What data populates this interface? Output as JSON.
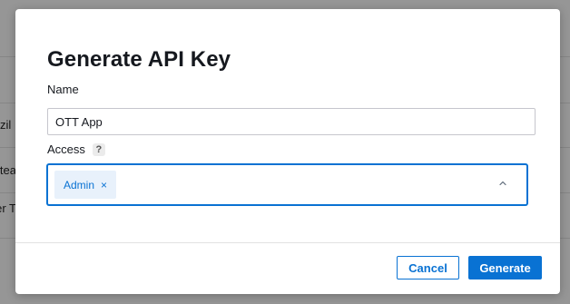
{
  "background": {
    "rows": [
      "zil",
      "tea",
      "er T"
    ]
  },
  "modal": {
    "title": "Generate API Key",
    "name_field": {
      "label": "Name",
      "value": "OTT App"
    },
    "access_field": {
      "label": "Access",
      "help_icon": "?",
      "selected_tokens": [
        "Admin"
      ],
      "remove_glyph": "×"
    },
    "buttons": {
      "cancel": "Cancel",
      "generate": "Generate"
    },
    "colors": {
      "accent": "#0972d3",
      "token_bg": "#e8f1fb",
      "text": "#16191f"
    },
    "icons": {
      "help": "help-icon",
      "token_remove": "close-icon",
      "dropdown": "chevron-up-icon"
    }
  }
}
